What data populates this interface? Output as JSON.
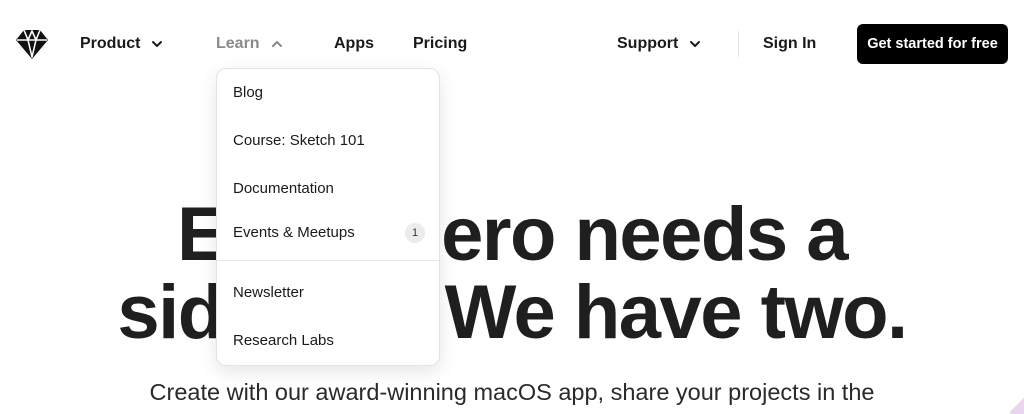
{
  "nav": {
    "product_label": "Product",
    "learn_label": "Learn",
    "apps_label": "Apps",
    "pricing_label": "Pricing",
    "support_label": "Support",
    "signin_label": "Sign In",
    "cta_label": "Get started for free"
  },
  "learn_menu": {
    "items": [
      {
        "label": "Blog"
      },
      {
        "label": "Course: Sketch 101"
      },
      {
        "label": "Documentation"
      },
      {
        "label": "Events & Meetups",
        "badge": "1"
      },
      {
        "label": "Newsletter"
      },
      {
        "label": "Research Labs"
      }
    ]
  },
  "hero": {
    "title_line1": "Every hero needs a",
    "title_line2": "sidekick. We have two.",
    "subtitle": "Create with our award-winning macOS app, share your projects in the"
  },
  "icons": {
    "logo": "diamond-logo-icon",
    "chevron_down": "chevron-down-icon",
    "chevron_up": "chevron-up-icon"
  },
  "colors": {
    "cta_background": "#000000",
    "muted_nav": "#8a8a8a",
    "text": "#1a1a1a"
  }
}
